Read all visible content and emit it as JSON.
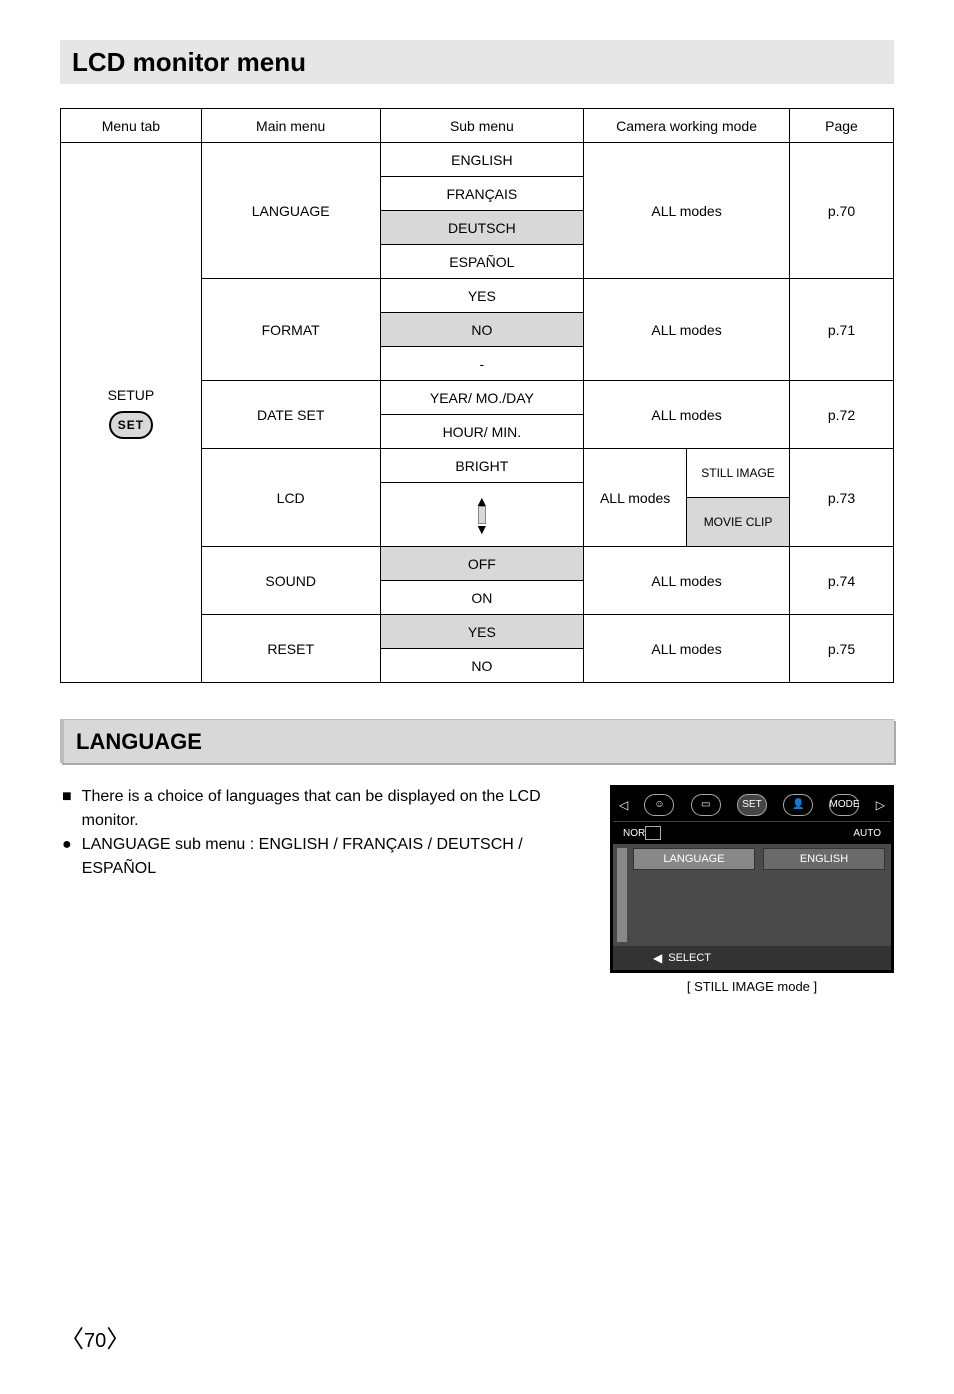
{
  "page_title": "LCD monitor menu",
  "table": {
    "headers": {
      "menu_tab": "Menu tab",
      "main_menu": "Main menu",
      "sub_menu": "Sub menu",
      "camera_working_mode": "Camera working mode",
      "page": "Page"
    },
    "menu_tab_cell": {
      "label": "SETUP",
      "badge": "SET"
    },
    "groups": [
      {
        "main_menu": "LANGUAGE",
        "page": "p.70",
        "rows": [
          {
            "sub_menu": "ENGLISH",
            "mode": "ALL modes",
            "shaded": false
          },
          {
            "sub_menu": "FRANÇAIS",
            "mode": "ALL modes",
            "shaded": false
          },
          {
            "sub_menu": "DEUTSCH",
            "mode": "ALL modes",
            "shaded": true
          },
          {
            "sub_menu": "ESPAÑOL",
            "mode": "ALL modes",
            "shaded": false
          }
        ]
      },
      {
        "main_menu": "FORMAT",
        "page": "p.71",
        "rows": [
          {
            "sub_menu": "YES",
            "mode": "ALL modes",
            "shaded": false
          },
          {
            "sub_menu": "NO",
            "mode": "ALL modes",
            "shaded": true
          },
          {
            "sub_menu": "-",
            "mode": "ALL modes",
            "shaded": false
          }
        ]
      },
      {
        "main_menu": "DATE SET",
        "page": "p.72",
        "rows": [
          {
            "sub_menu": "YEAR/ MO./DAY",
            "mode": "ALL modes",
            "shaded": false
          },
          {
            "sub_menu": "HOUR/ MIN.",
            "mode": "ALL modes",
            "shaded": false
          }
        ]
      },
      {
        "main_menu": "LCD",
        "page": "p.73",
        "lcd_widget": true,
        "rows": [
          {
            "sub_menu": "BRIGHT",
            "mode": "ALL modes / STILL IMAGE",
            "shaded": false
          },
          {
            "sub_menu_widget": true,
            "mode_mode": "ALL modes",
            "mode_sub_top": "STILL IMAGE",
            "mode_sub_bottom_shaded": true,
            "mode_sub_bottom": "MOVIE CLIP"
          }
        ]
      },
      {
        "main_menu": "SOUND",
        "page": "p.74",
        "rows": [
          {
            "sub_menu": "OFF",
            "mode": "ALL modes",
            "shaded": true
          },
          {
            "sub_menu": "ON",
            "mode": "ALL modes",
            "shaded": false
          }
        ]
      },
      {
        "main_menu": "RESET",
        "page": "p.75",
        "rows": [
          {
            "sub_menu": "YES",
            "mode": "ALL modes",
            "shaded": true
          },
          {
            "sub_menu": "NO",
            "mode": "ALL modes",
            "shaded": false
          }
        ]
      }
    ]
  },
  "section_title": "LANGUAGE",
  "body": {
    "line1_marker": "■",
    "line1": "There is a choice of languages that can be displayed on the LCD monitor.",
    "line2_marker": "●",
    "line2": "LANGUAGE sub menu : ENGLISH / FRANÇAIS / DEUTSCH / ESPAÑOL"
  },
  "lcd_preview": {
    "top_icons": {
      "left_tri": "◁",
      "palette": "palette-icon",
      "doc": "doc-icon",
      "set": "SET",
      "person": "person-icon",
      "mode": "MODE",
      "right_tri": "▷"
    },
    "subbar": {
      "left": "NOR",
      "right": "AUTO"
    },
    "cells": {
      "left": "LANGUAGE",
      "right": "ENGLISH"
    },
    "footer": {
      "tri": "◀",
      "label": "SELECT"
    },
    "caption": "[ STILL IMAGE mode ]"
  },
  "page_number": "70"
}
